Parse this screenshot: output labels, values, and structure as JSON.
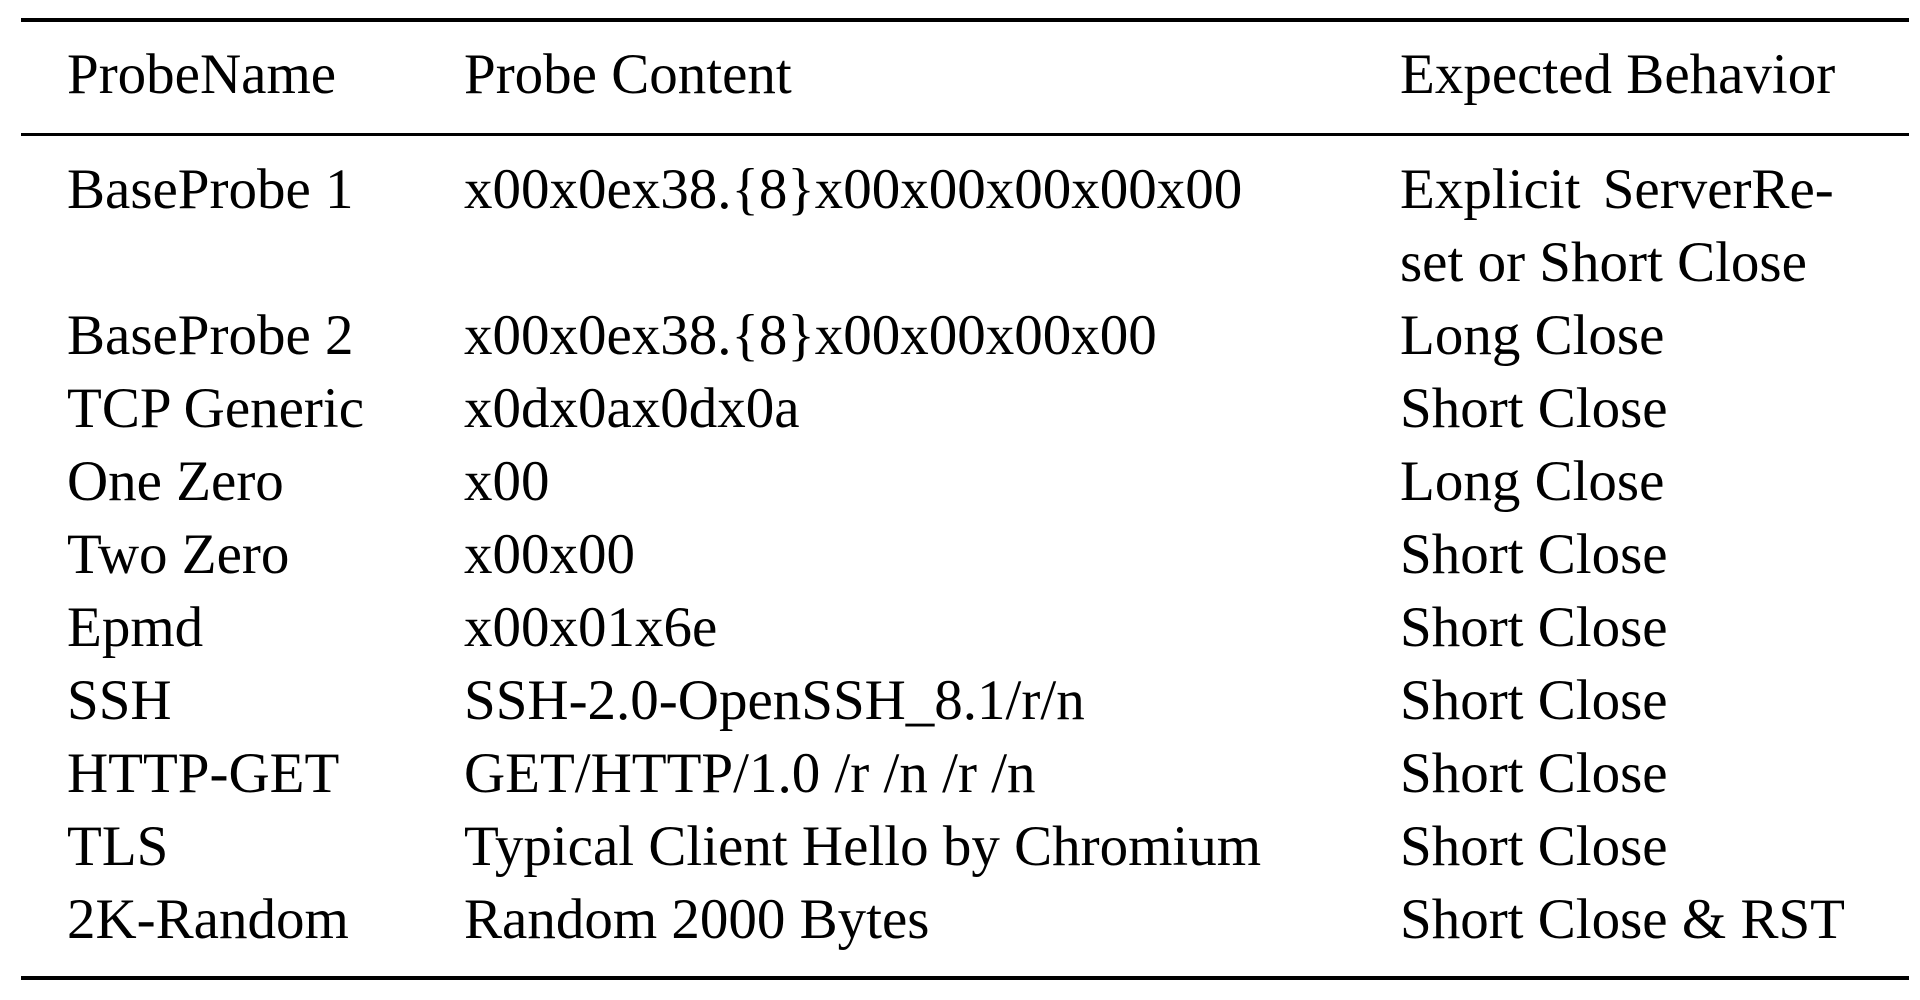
{
  "table": {
    "headers": [
      "ProbeName",
      "Probe Content",
      "Expected Behavior"
    ],
    "rows": [
      {
        "name": "BaseProbe 1",
        "content": "x00x0ex38.{8}x00x00x00x00x00",
        "behavior_lines": [
          "Explicit  ServerRe-",
          "set or Short Close"
        ]
      },
      {
        "name": "BaseProbe 2",
        "content": "x00x0ex38.{8}x00x00x00x00",
        "behavior_lines": [
          "Long Close"
        ]
      },
      {
        "name": "TCP Generic",
        "content": "x0dx0ax0dx0a",
        "behavior_lines": [
          "Short Close"
        ]
      },
      {
        "name": "One Zero",
        "content": "x00",
        "behavior_lines": [
          "Long Close"
        ]
      },
      {
        "name": "Two Zero",
        "content": "x00x00",
        "behavior_lines": [
          "Short Close"
        ]
      },
      {
        "name": "Epmd",
        "content": "x00x01x6e",
        "behavior_lines": [
          "Short Close"
        ]
      },
      {
        "name": "SSH",
        "content": "SSH-2.0-OpenSSH_8.1/r/n",
        "behavior_lines": [
          "Short Close"
        ]
      },
      {
        "name": "HTTP-GET",
        "content": "GET/HTTP/1.0 /r /n /r /n",
        "behavior_lines": [
          "Short Close"
        ]
      },
      {
        "name": "TLS",
        "content": "Typical Client Hello by Chromium",
        "behavior_lines": [
          "Short Close"
        ]
      },
      {
        "name": "2K-Random",
        "content": "Random 2000 Bytes",
        "behavior_lines": [
          "Short Close & RST"
        ]
      }
    ]
  }
}
